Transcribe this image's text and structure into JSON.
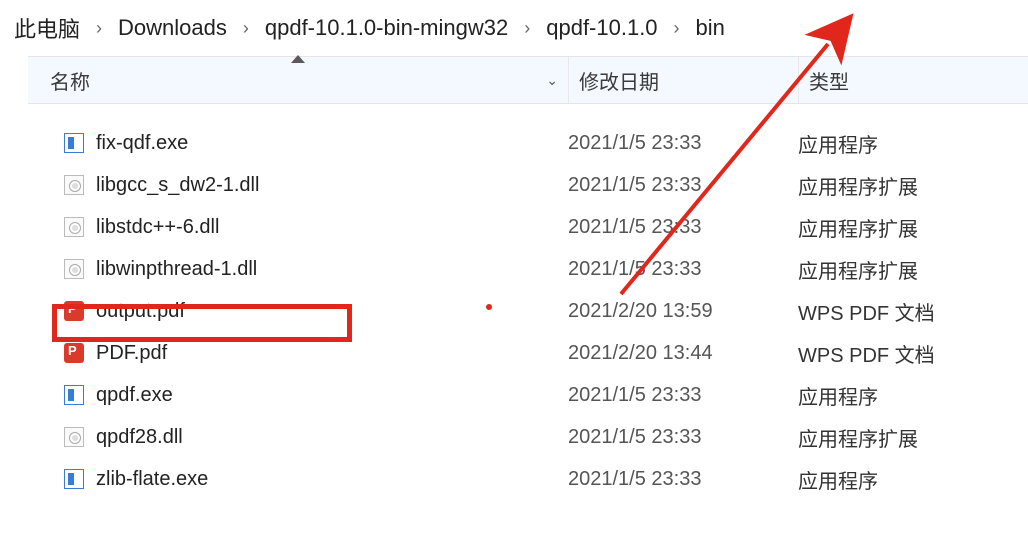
{
  "breadcrumb": {
    "items": [
      "此电脑",
      "Downloads",
      "qpdf-10.1.0-bin-mingw32",
      "qpdf-10.1.0",
      "bin"
    ]
  },
  "columns": {
    "name": "名称",
    "date": "修改日期",
    "type": "类型"
  },
  "files": [
    {
      "icon": "exe",
      "name": "fix-qdf.exe",
      "date": "2021/1/5 23:33",
      "type": "应用程序"
    },
    {
      "icon": "dll",
      "name": "libgcc_s_dw2-1.dll",
      "date": "2021/1/5 23:33",
      "type": "应用程序扩展"
    },
    {
      "icon": "dll",
      "name": "libstdc++-6.dll",
      "date": "2021/1/5 23:33",
      "type": "应用程序扩展"
    },
    {
      "icon": "dll",
      "name": "libwinpthread-1.dll",
      "date": "2021/1/5 23:33",
      "type": "应用程序扩展"
    },
    {
      "icon": "pdf",
      "name": "output.pdf",
      "date": "2021/2/20 13:59",
      "type": "WPS PDF 文档"
    },
    {
      "icon": "pdf",
      "name": "PDF.pdf",
      "date": "2021/2/20 13:44",
      "type": "WPS PDF 文档"
    },
    {
      "icon": "exe",
      "name": "qpdf.exe",
      "date": "2021/1/5 23:33",
      "type": "应用程序"
    },
    {
      "icon": "dll",
      "name": "qpdf28.dll",
      "date": "2021/1/5 23:33",
      "type": "应用程序扩展"
    },
    {
      "icon": "exe",
      "name": "zlib-flate.exe",
      "date": "2021/1/5 23:33",
      "type": "应用程序"
    }
  ],
  "annotations": {
    "highlight_file_index": 4,
    "arrow_color": "#e1261c"
  }
}
